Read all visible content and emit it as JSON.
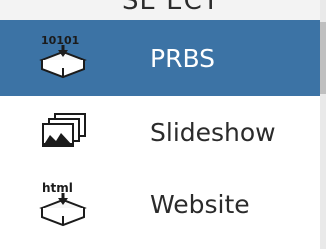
{
  "menu": {
    "header_text": "SE ECT",
    "accent_color": "#3c73a5",
    "items": [
      {
        "label": "PRBS",
        "icon": "prbs-export-icon",
        "icon_text": "10101",
        "selected": true
      },
      {
        "label": "Slideshow",
        "icon": "slideshow-icon",
        "selected": false
      },
      {
        "label": "Website",
        "icon": "website-export-icon",
        "icon_text": "html",
        "selected": false
      }
    ]
  }
}
